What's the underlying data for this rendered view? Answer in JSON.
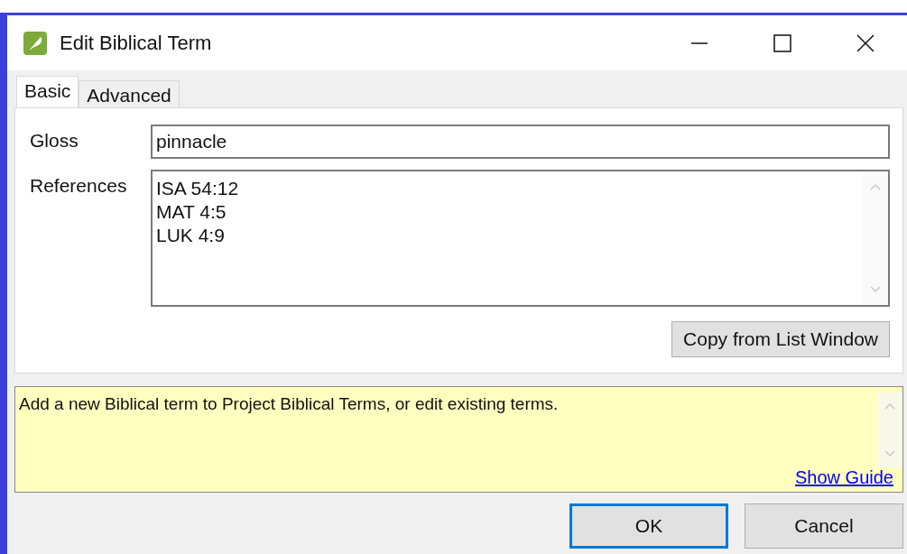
{
  "window": {
    "title": "Edit Biblical Term"
  },
  "tabs": [
    {
      "label": "Basic",
      "selected": true
    },
    {
      "label": "Advanced",
      "selected": false
    }
  ],
  "form": {
    "gloss_label": "Gloss",
    "gloss_value": "pinnacle",
    "references_label": "References",
    "references": [
      "ISA 54:12",
      "MAT 4:5",
      "LUK 4:9"
    ],
    "copy_button": "Copy from List Window"
  },
  "help": {
    "text": "Add a new Biblical term to Project Biblical Terms, or edit existing terms.",
    "link": "Show Guide"
  },
  "buttons": [
    {
      "label": "OK",
      "focused": true
    },
    {
      "label": "Cancel",
      "focused": false
    }
  ]
}
